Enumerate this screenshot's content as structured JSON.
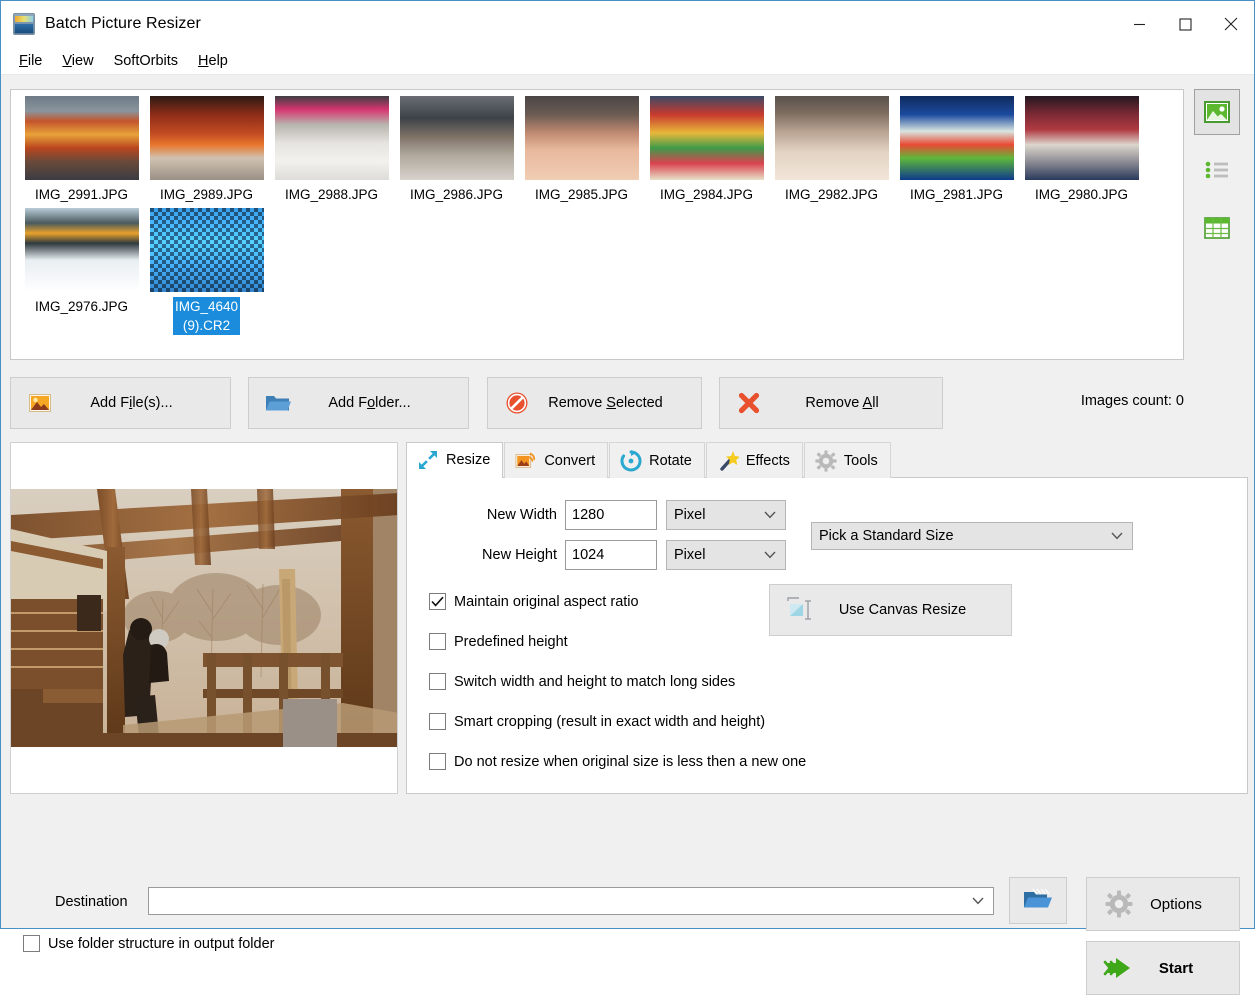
{
  "window": {
    "title": "Batch Picture Resizer",
    "icon": "app-icon",
    "minimize": "─",
    "maximize": "□",
    "close": "✕"
  },
  "menubar": {
    "items": [
      {
        "label": "File",
        "accel": "F"
      },
      {
        "label": "View",
        "accel": "V"
      },
      {
        "label": "SoftOrbits",
        "accel": ""
      },
      {
        "label": "Help",
        "accel": "H"
      }
    ]
  },
  "thumbnails": {
    "items": [
      {
        "label": "IMG_2991.JPG",
        "selected": false
      },
      {
        "label": "IMG_2989.JPG",
        "selected": false
      },
      {
        "label": "IMG_2988.JPG",
        "selected": false
      },
      {
        "label": "IMG_2986.JPG",
        "selected": false
      },
      {
        "label": "IMG_2985.JPG",
        "selected": false
      },
      {
        "label": "IMG_2984.JPG",
        "selected": false
      },
      {
        "label": "IMG_2982.JPG",
        "selected": false
      },
      {
        "label": "IMG_2981.JPG",
        "selected": false
      },
      {
        "label": "IMG_2980.JPG",
        "selected": false
      },
      {
        "label": "IMG_2976.JPG",
        "selected": false
      },
      {
        "label": "IMG_4640\n(9).CR2",
        "selected": true
      }
    ],
    "selection_color": "#1a8cdb"
  },
  "view_modes": [
    {
      "name": "thumbnail-view",
      "icon": "image-icon",
      "active": true
    },
    {
      "name": "list-view",
      "icon": "list-icon",
      "active": false
    },
    {
      "name": "details-view",
      "icon": "table-icon",
      "active": false
    }
  ],
  "actions": {
    "add_files": {
      "label_pre": "Add F",
      "accel": "i",
      "label_post": "le(s)...",
      "icon": "picture-icon"
    },
    "add_folder": {
      "label_pre": "Add F",
      "accel": "o",
      "label_post": "lder...",
      "icon": "folder-icon"
    },
    "remove_selected": {
      "label_pre": "Remove ",
      "accel": "S",
      "label_post": "elected",
      "icon": "prohibit-icon"
    },
    "remove_all": {
      "label_pre": "Remove ",
      "accel": "A",
      "label_post": "ll",
      "icon": "red-x-icon"
    },
    "images_count": "Images count: 0"
  },
  "tabs": [
    {
      "label": "Resize",
      "icon": "resize-arrows-icon",
      "active": true
    },
    {
      "label": "Convert",
      "icon": "convert-icon",
      "active": false
    },
    {
      "label": "Rotate",
      "icon": "rotate-icon",
      "active": false
    },
    {
      "label": "Effects",
      "icon": "magic-wand-icon",
      "active": false
    },
    {
      "label": "Tools",
      "icon": "gear-icon",
      "active": false
    }
  ],
  "resize": {
    "width_label": "New Width",
    "width_value": "1280",
    "width_unit": "Pixel",
    "height_label": "New Height",
    "height_value": "1024",
    "height_unit": "Pixel",
    "standard_size": "Pick a Standard Size",
    "canvas_resize": "Use Canvas Resize",
    "options": [
      {
        "label": "Maintain original aspect ratio",
        "checked": true
      },
      {
        "label": "Predefined height",
        "checked": false
      },
      {
        "label": "Switch width and height to match long sides",
        "checked": false
      },
      {
        "label": "Smart cropping (result in exact width and height)",
        "checked": false
      },
      {
        "label": "Do not resize when original size is less then a new one",
        "checked": false
      }
    ]
  },
  "bottom": {
    "destination_label": "Destination",
    "destination_value": "",
    "destination_placeholder": "",
    "browse_icon": "open-folder-icon",
    "use_folder_structure": {
      "label": "Use folder structure in output folder",
      "checked": false
    },
    "options_button": "Options",
    "options_icon": "gear-icon",
    "start_button": "Start",
    "start_icon": "green-arrow-icon"
  },
  "colors": {
    "accent_blue": "#1a8cdb",
    "window_border": "#4a90c4",
    "panel_bg": "#f0f0f0",
    "button_bg": "#e9e9e9",
    "green": "#4caf2f"
  }
}
